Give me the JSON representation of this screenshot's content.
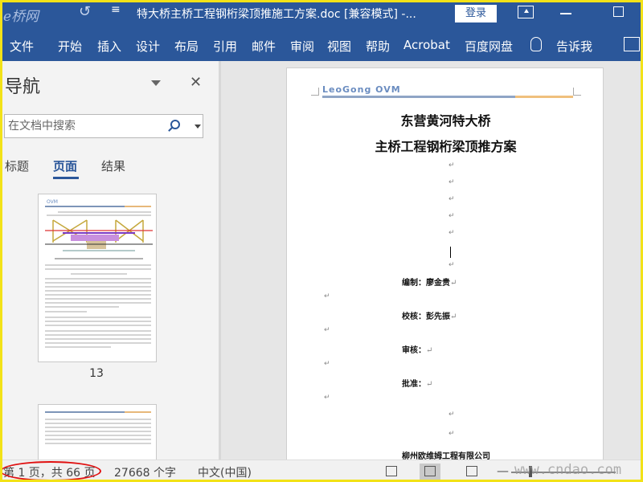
{
  "titlebar": {
    "logo": "e桥网",
    "quick_access": "≡",
    "doc_title": "特大桥主桥工程钢桁梁顶推施工方案.doc [兼容模式] -...",
    "login_label": "登录"
  },
  "ribbon": {
    "tabs": [
      "文件",
      "开始",
      "插入",
      "设计",
      "布局",
      "引用",
      "邮件",
      "审阅",
      "视图",
      "帮助",
      "Acrobat",
      "百度网盘"
    ],
    "tell_me": "告诉我"
  },
  "nav": {
    "title": "导航",
    "close": "✕",
    "search_placeholder": "在文档中搜索",
    "tabs": [
      "标题",
      "页面",
      "结果"
    ],
    "active_tab": "页面",
    "thumb_logo": "OVM",
    "thumb_page_number": "13"
  },
  "document": {
    "logo": "LeoGong OVM",
    "title_line1": "东营黄河特大桥",
    "title_line2": "主桥工程钢桁梁顶推方案",
    "mark": "↵",
    "fields": [
      {
        "label": "编制：",
        "value": "廖金贵"
      },
      {
        "label": "校核：",
        "value": "彭先振"
      },
      {
        "label": "审核：",
        "value": ""
      },
      {
        "label": "批准：",
        "value": ""
      }
    ],
    "company": "柳州欧维姆工程有限公司"
  },
  "status": {
    "page_info": "第 1 页，共 66 页",
    "word_count": "27668 个字",
    "language": "中文(中国)",
    "zoom_minus": "—",
    "watermark": "www.cndao.com"
  },
  "colors": {
    "word_blue": "#2b579a",
    "highlight_circle": "#e01010",
    "frame": "#f2e218"
  }
}
